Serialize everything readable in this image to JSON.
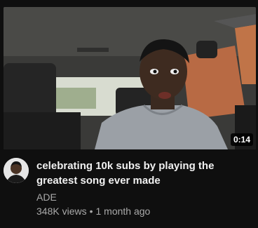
{
  "video": {
    "duration": "0:14",
    "title": "celebrating 10k subs by playing the greatest song ever made",
    "channel": "ADE",
    "views": "348K views",
    "separator": "•",
    "age": "1 month ago"
  },
  "icons": {
    "avatar": "channel-avatar",
    "thumbnail": "video-thumbnail"
  },
  "colors": {
    "background": "#0f0f0f",
    "title": "#f1f1f1",
    "meta": "#aaaaaa"
  }
}
